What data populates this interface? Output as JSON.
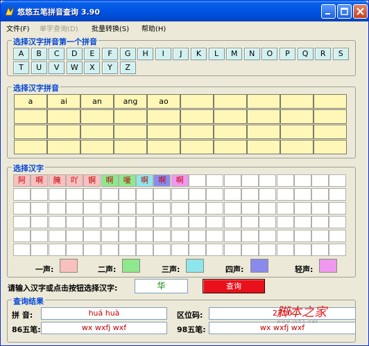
{
  "window": {
    "title": "悠悠五笔拼音查询 3.90"
  },
  "menu": [
    {
      "label": "文件(F)",
      "enabled": true
    },
    {
      "label": "单字查询(D)",
      "enabled": false
    },
    {
      "label": "批量转换(S)",
      "enabled": true
    },
    {
      "label": "帮助(H)",
      "enabled": true
    }
  ],
  "first_letter_group": {
    "title": "选择汉字拼音第一个拼音",
    "letters": [
      "A",
      "B",
      "C",
      "D",
      "E",
      "F",
      "G",
      "H",
      "I",
      "J",
      "K",
      "L",
      "M",
      "N",
      "O",
      "P",
      "Q",
      "R",
      "S",
      "T",
      "U",
      "V",
      "W",
      "X",
      "Y",
      "Z"
    ]
  },
  "pinyin_group": {
    "title": "选择汉字拼音",
    "syllables": [
      "a",
      "ai",
      "an",
      "ang",
      "ao"
    ]
  },
  "hanzi_group": {
    "title": "选择汉字",
    "characters": [
      {
        "char": "阿",
        "tone": 1
      },
      {
        "char": "啊",
        "tone": 1
      },
      {
        "char": "腌",
        "tone": 1
      },
      {
        "char": "吖",
        "tone": 1
      },
      {
        "char": "锕",
        "tone": 1
      },
      {
        "char": "啊",
        "tone": 2
      },
      {
        "char": "嗄",
        "tone": 2
      },
      {
        "char": "啊",
        "tone": 3
      },
      {
        "char": "啊",
        "tone": 4
      },
      {
        "char": "啊",
        "tone": 5
      }
    ]
  },
  "tones": [
    {
      "label": "一声:",
      "color": "#f9c0c0"
    },
    {
      "label": "二声:",
      "color": "#8ee88e"
    },
    {
      "label": "三声:",
      "color": "#8ee6ec"
    },
    {
      "label": "四声:",
      "color": "#8a8aee"
    },
    {
      "label": "轻声:",
      "color": "#f098f0"
    }
  ],
  "query": {
    "prompt": "请输入汉字或点击按钮选择汉字:",
    "input_value": "华",
    "button_label": "查询"
  },
  "result": {
    "title": "查询结果",
    "pinyin_label": "拼 音:",
    "pinyin_value": "huá  huà",
    "quwei_label": "区位码:",
    "quwei_value": "2710",
    "wubi86_label": "86五笔:",
    "wubi86_value": "wx wxfj wxf",
    "wubi98_label": "98五笔:",
    "wubi98_value": "wx wxfj wxf"
  },
  "watermark": {
    "main": "脚本之家",
    "sub": "www.jb51.net"
  }
}
